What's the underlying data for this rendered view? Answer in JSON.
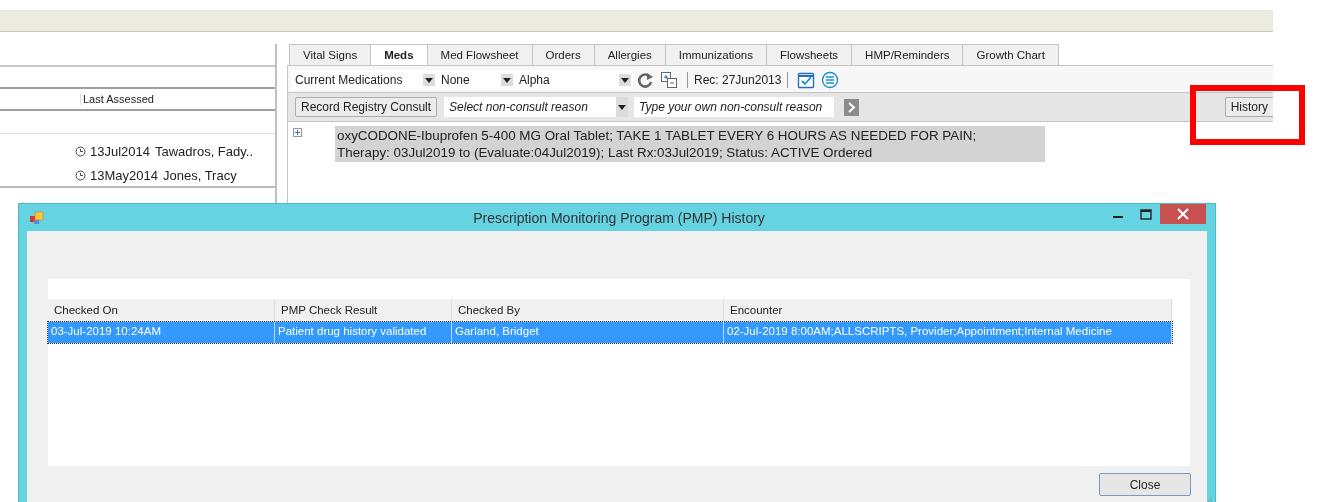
{
  "patient_list": {
    "columns": [
      "Last Assessed"
    ],
    "rows": [
      {
        "date": "13Jul2014",
        "name": "Tawadros,  Fady.."
      },
      {
        "date": "13May2014",
        "name": "Jones, Tracy"
      }
    ]
  },
  "tabs": [
    {
      "label": "Vital Signs",
      "selected": false
    },
    {
      "label": "Meds",
      "selected": true
    },
    {
      "label": "Med Flowsheet",
      "selected": false
    },
    {
      "label": "Orders",
      "selected": false
    },
    {
      "label": "Allergies",
      "selected": false
    },
    {
      "label": "Immunizations",
      "selected": false
    },
    {
      "label": "Flowsheets",
      "selected": false
    },
    {
      "label": "HMP/Reminders",
      "selected": false
    },
    {
      "label": "Growth Chart",
      "selected": false
    }
  ],
  "toolbar": {
    "filters": [
      "Current Medications",
      "None",
      "Alpha"
    ],
    "record_date": "Rec: 27Jun2013"
  },
  "consult_bar": {
    "consult_button": "Record Registry Consult",
    "reason_select": {
      "placeholder": "Select non-consult reason"
    },
    "reason_input": {
      "placeholder": "Type your own non-consult reason"
    },
    "history_button": "History"
  },
  "medications": [
    {
      "expanded": false,
      "lines": [
        "oxyCODONE-Ibuprofen 5-400 MG Oral Tablet; TAKE 1 TABLET EVERY 6 HOURS AS NEEDED FOR PAIN;",
        "Therapy: 03Jul2019 to (Evaluate:04Jul2019); Last Rx:03Jul2019; Status: ACTIVE Ordered"
      ]
    }
  ],
  "dialog": {
    "title": "Prescription Monitoring Program (PMP) History",
    "columns": [
      "Checked On",
      "PMP Check Result",
      "Checked By",
      "Encounter"
    ],
    "rows": [
      {
        "selected": true,
        "cells": [
          "03-Jul-2019 10:24AM",
          "Patient drug history validated",
          "Garland, Bridget",
          "02-Jul-2019 8:00AM;ALLSCRIPTS, Provider;Appointment;Internal Medicine"
        ]
      }
    ],
    "buttons": [
      "Close"
    ]
  }
}
